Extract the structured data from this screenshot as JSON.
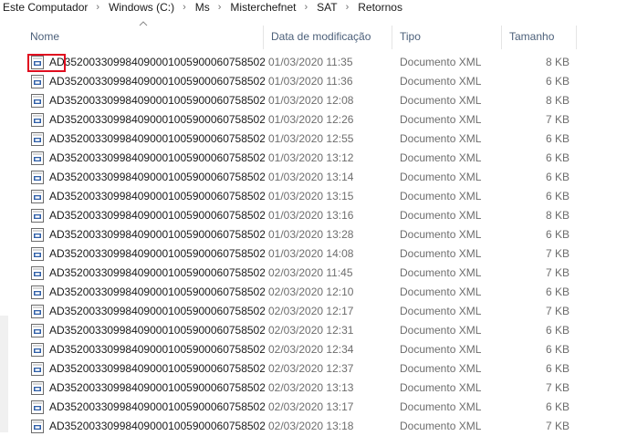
{
  "breadcrumb": [
    "Este Computador",
    "Windows (C:)",
    "Ms",
    "Misterchefnet",
    "SAT",
    "Retornos"
  ],
  "columns": {
    "name": "Nome",
    "date": "Data de modificação",
    "type": "Tipo",
    "size": "Tamanho"
  },
  "icons": {
    "sort": "chevron-up-icon",
    "file": "xml-file-icon",
    "separator": "chevron-right-icon"
  },
  "colors": {
    "highlight": "#e00d1f",
    "header_text": "#4c607a"
  },
  "files": [
    {
      "name": "AD35200330998409000100590006075850​2...",
      "date": "01/03/2020 11:35",
      "type": "Documento XML",
      "size": "8 KB"
    },
    {
      "name": "AD352003309984090001005900060758502...",
      "date": "01/03/2020 11:36",
      "type": "Documento XML",
      "size": "6 KB"
    },
    {
      "name": "AD352003309984090001005900060758502...",
      "date": "01/03/2020 12:08",
      "type": "Documento XML",
      "size": "8 KB"
    },
    {
      "name": "AD352003309984090001005900060758502...",
      "date": "01/03/2020 12:26",
      "type": "Documento XML",
      "size": "7 KB"
    },
    {
      "name": "AD352003309984090001005900060758502...",
      "date": "01/03/2020 12:55",
      "type": "Documento XML",
      "size": "6 KB"
    },
    {
      "name": "AD352003309984090001005900060758502...",
      "date": "01/03/2020 13:12",
      "type": "Documento XML",
      "size": "6 KB"
    },
    {
      "name": "AD352003309984090001005900060758502...",
      "date": "01/03/2020 13:14",
      "type": "Documento XML",
      "size": "6 KB"
    },
    {
      "name": "AD352003309984090001005900060758502...",
      "date": "01/03/2020 13:15",
      "type": "Documento XML",
      "size": "6 KB"
    },
    {
      "name": "AD352003309984090001005900060758502...",
      "date": "01/03/2020 13:16",
      "type": "Documento XML",
      "size": "8 KB"
    },
    {
      "name": "AD352003309984090001005900060758502...",
      "date": "01/03/2020 13:28",
      "type": "Documento XML",
      "size": "6 KB"
    },
    {
      "name": "AD352003309984090001005900060758502...",
      "date": "01/03/2020 14:08",
      "type": "Documento XML",
      "size": "7 KB"
    },
    {
      "name": "AD352003309984090001005900060758502...",
      "date": "02/03/2020 11:45",
      "type": "Documento XML",
      "size": "7 KB"
    },
    {
      "name": "AD352003309984090001005900060758502...",
      "date": "02/03/2020 12:10",
      "type": "Documento XML",
      "size": "6 KB"
    },
    {
      "name": "AD352003309984090001005900060758502...",
      "date": "02/03/2020 12:17",
      "type": "Documento XML",
      "size": "7 KB"
    },
    {
      "name": "AD352003309984090001005900060758502...",
      "date": "02/03/2020 12:31",
      "type": "Documento XML",
      "size": "6 KB"
    },
    {
      "name": "AD352003309984090001005900060758502...",
      "date": "02/03/2020 12:34",
      "type": "Documento XML",
      "size": "6 KB"
    },
    {
      "name": "AD352003309984090001005900060758502...",
      "date": "02/03/2020 12:37",
      "type": "Documento XML",
      "size": "6 KB"
    },
    {
      "name": "AD352003309984090001005900060758502...",
      "date": "02/03/2020 13:13",
      "type": "Documento XML",
      "size": "7 KB"
    },
    {
      "name": "AD352003309984090001005900060758502...",
      "date": "02/03/2020 13:17",
      "type": "Documento XML",
      "size": "6 KB"
    },
    {
      "name": "AD352003309984090001005900060758502...",
      "date": "02/03/2020 13:18",
      "type": "Documento XML",
      "size": "7 KB"
    }
  ]
}
